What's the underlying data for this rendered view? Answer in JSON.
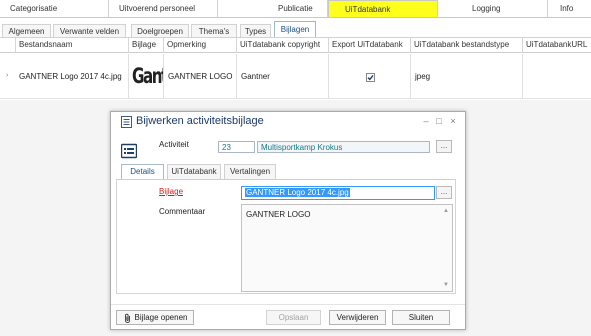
{
  "top_tabs": [
    "Categorisatie",
    "Uitvoerend personeel",
    "Publicatie",
    "UiTdatabank",
    "Logging",
    "Info"
  ],
  "sub_tabs": [
    "Algemeen",
    "Verwante velden",
    "Doelgroepen",
    "Thema's",
    "Types",
    "Bijlagen"
  ],
  "grid": {
    "columns": [
      "Bestandsnaam",
      "Bijlage",
      "Opmerking",
      "UiTdatabank copyright",
      "Export UiTdatabank",
      "UiTdatabank bestandstype",
      "UiTdatabankURL"
    ],
    "row": {
      "bestandsnaam": "GANTNER Logo 2017 4c.jpg",
      "bijlage_logo": "Gantn",
      "opmerking": "GANTNER LOGO",
      "copyright": "Gantner",
      "export_checked": true,
      "bestandstype": "jpeg",
      "url": ""
    }
  },
  "dialog": {
    "title": "Bijwerken activiteitsbijlage",
    "controls": {
      "minimize": "–",
      "maximize": "□",
      "close": "×"
    },
    "activiteit_label": "Activiteit",
    "activiteit_id": "23",
    "activiteit_name": "Multisportkamp Krokus",
    "dots": "...",
    "tabs": [
      "Details",
      "UiTdatabank",
      "Vertalingen"
    ],
    "bijlage_label": "Bijlage",
    "bijlage_value": "GANTNER Logo 2017 4c.jpg",
    "commentaar_label": "Commentaar",
    "commentaar_value": "GANTNER LOGO",
    "buttons": {
      "open": "Bijlage openen",
      "save": "Opslaan",
      "delete": "Verwijderen",
      "close": "Sluiten"
    }
  },
  "colors": {
    "active_top_tab": "#ffff1e",
    "link_red": "#d11f1f",
    "selection_blue": "#3399ff",
    "field_teal": "#1a7a86"
  }
}
